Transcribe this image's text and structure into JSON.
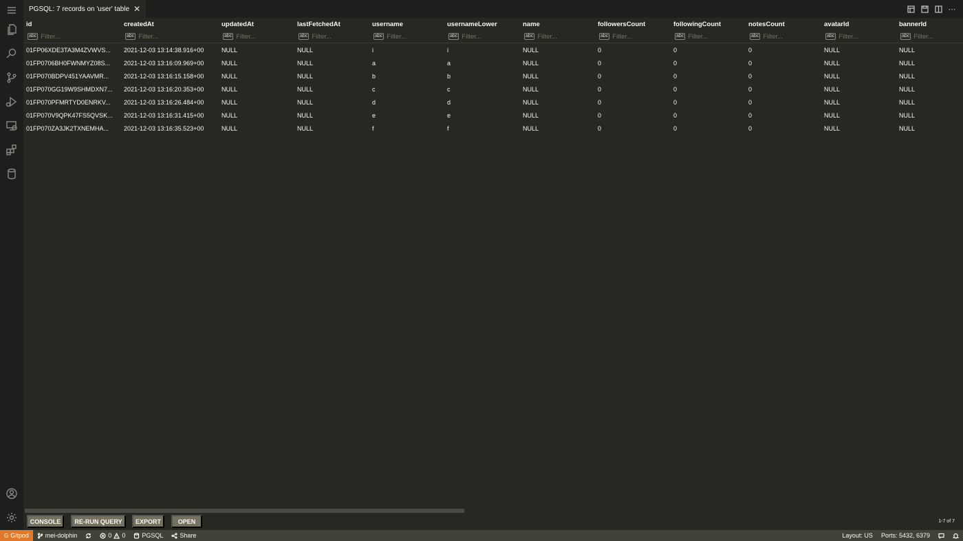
{
  "tab": {
    "title": "PGSQL: 7 records on 'user' table",
    "close": "✕"
  },
  "columns": [
    "id",
    "createdAt",
    "updatedAt",
    "lastFetchedAt",
    "username",
    "usernameLower",
    "name",
    "followersCount",
    "followingCount",
    "notesCount",
    "avatarId",
    "bannerId"
  ],
  "filter": {
    "placeholder": "Filter...",
    "type_label": "abc"
  },
  "rows": [
    [
      "01FP06XDE3TA3M4ZVWVS...",
      "2021-12-03 13:14:38.916+00",
      "NULL",
      "NULL",
      "i",
      "i",
      "NULL",
      "0",
      "0",
      "0",
      "NULL",
      "NULL"
    ],
    [
      "01FP0706BH0FWNMYZ08S...",
      "2021-12-03 13:16:09.969+00",
      "NULL",
      "NULL",
      "a",
      "a",
      "NULL",
      "0",
      "0",
      "0",
      "NULL",
      "NULL"
    ],
    [
      "01FP070BDPV451YAAVMR...",
      "2021-12-03 13:16:15.158+00",
      "NULL",
      "NULL",
      "b",
      "b",
      "NULL",
      "0",
      "0",
      "0",
      "NULL",
      "NULL"
    ],
    [
      "01FP070GG19W9SHMDXN7...",
      "2021-12-03 13:16:20.353+00",
      "NULL",
      "NULL",
      "c",
      "c",
      "NULL",
      "0",
      "0",
      "0",
      "NULL",
      "NULL"
    ],
    [
      "01FP070PFMRTYD0ENRKV...",
      "2021-12-03 13:16:26.484+00",
      "NULL",
      "NULL",
      "d",
      "d",
      "NULL",
      "0",
      "0",
      "0",
      "NULL",
      "NULL"
    ],
    [
      "01FP070V9QPK47FS5QVSK...",
      "2021-12-03 13:16:31.415+00",
      "NULL",
      "NULL",
      "e",
      "e",
      "NULL",
      "0",
      "0",
      "0",
      "NULL",
      "NULL"
    ],
    [
      "01FP070ZA3JK2TXNEMHA...",
      "2021-12-03 13:16:35.523+00",
      "NULL",
      "NULL",
      "f",
      "f",
      "NULL",
      "0",
      "0",
      "0",
      "NULL",
      "NULL"
    ]
  ],
  "toolbar": {
    "console": "CONSOLE",
    "rerun": "RE-RUN QUERY",
    "export": "EXPORT",
    "open": "OPEN",
    "pager": "1-7 of 7"
  },
  "statusbar": {
    "remote": "Gitpod",
    "branch": "mei-dolphin",
    "errors": "0",
    "warnings": "0",
    "db": "PGSQL",
    "share": "Share",
    "layout": "Layout: US",
    "ports": "Ports: 5432, 6379"
  },
  "colors": {
    "background": "#272822",
    "button": "#75715e",
    "remote": "#e07a2a",
    "statusbar": "#414339"
  }
}
